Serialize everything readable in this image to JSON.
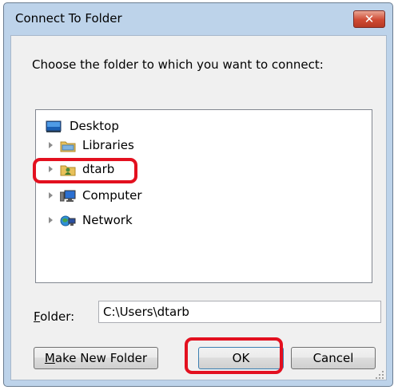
{
  "window": {
    "title": "Connect To Folder",
    "close_label": "✕"
  },
  "prompt": "Choose the folder to which you want to connect:",
  "tree": {
    "items": [
      {
        "label": "Desktop",
        "icon": "desktop-icon",
        "expandable": false
      },
      {
        "label": "Libraries",
        "icon": "libraries-icon",
        "expandable": true
      },
      {
        "label": "dtarb",
        "icon": "user-folder-icon",
        "expandable": true,
        "highlighted": true
      },
      {
        "label": "Computer",
        "icon": "computer-icon",
        "expandable": true
      },
      {
        "label": "Network",
        "icon": "network-icon",
        "expandable": true
      }
    ]
  },
  "folder": {
    "label": "Folder:",
    "value": "C:\\Users\\dtarb"
  },
  "buttons": {
    "make_new_folder": "Make New Folder",
    "ok": "OK",
    "cancel": "Cancel"
  },
  "colors": {
    "highlight": "#e3101f",
    "titlebar": "#bdd3ea",
    "close_button": "#cf4a33"
  }
}
